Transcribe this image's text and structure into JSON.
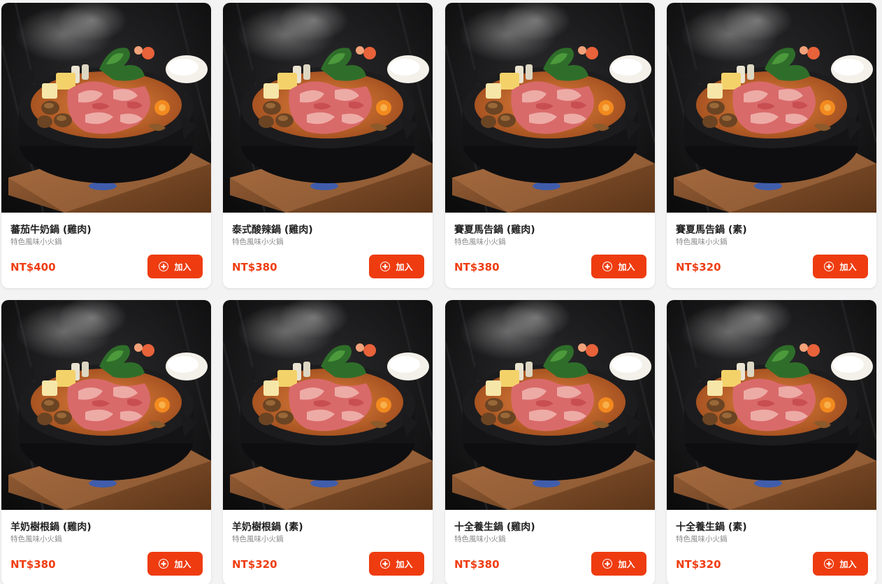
{
  "colors": {
    "accent": "#ee3c10",
    "price": "#ef3d12",
    "card_bg": "#ffffff",
    "page_bg": "#f3f3f3"
  },
  "icons": {
    "add": "plus-circle-icon",
    "product_photo": "hot-pot-photo"
  },
  "products": [
    {
      "name": "蕃茄牛奶鍋 (雞肉)",
      "desc": "特色風味小火鍋",
      "price": "NT$400",
      "button": "加入"
    },
    {
      "name": "泰式酸辣鍋 (雞肉)",
      "desc": "特色風味小火鍋",
      "price": "NT$380",
      "button": "加入"
    },
    {
      "name": "賽夏馬告鍋 (雞肉)",
      "desc": "特色風味小火鍋",
      "price": "NT$380",
      "button": "加入"
    },
    {
      "name": "賽夏馬告鍋 (素)",
      "desc": "特色風味小火鍋",
      "price": "NT$320",
      "button": "加入"
    },
    {
      "name": "羊奶樹根鍋 (雞肉)",
      "desc": "特色風味小火鍋",
      "price": "NT$380",
      "button": "加入"
    },
    {
      "name": "羊奶樹根鍋 (素)",
      "desc": "特色風味小火鍋",
      "price": "NT$320",
      "button": "加入"
    },
    {
      "name": "十全養生鍋 (雞肉)",
      "desc": "特色風味小火鍋",
      "price": "NT$380",
      "button": "加入"
    },
    {
      "name": "十全養生鍋 (素)",
      "desc": "特色風味小火鍋",
      "price": "NT$320",
      "button": "加入"
    }
  ]
}
